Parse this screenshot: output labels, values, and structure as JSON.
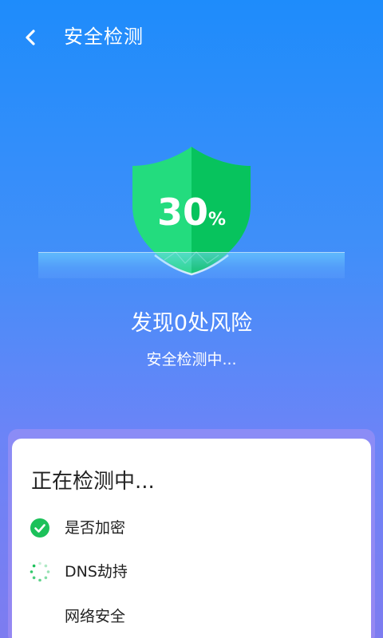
{
  "header": {
    "title": "安全检测"
  },
  "shield": {
    "percent_value": "30",
    "percent_sign": "%",
    "progress": 0.3
  },
  "status": {
    "title": "发现0处风险",
    "subtitle": "安全检测中..."
  },
  "card": {
    "title": "正在检测中...",
    "items": [
      {
        "label": "是否加密",
        "state": "done"
      },
      {
        "label": "DNS劫持",
        "state": "scanning"
      },
      {
        "label": "网络安全",
        "state": "pending"
      }
    ]
  },
  "colors": {
    "shield_light": "#23dc7e",
    "shield_dark": "#07c35d",
    "check_green": "#1cc15a",
    "background_top": "#1e8cfb",
    "background_bottom": "#7d7cf0"
  }
}
